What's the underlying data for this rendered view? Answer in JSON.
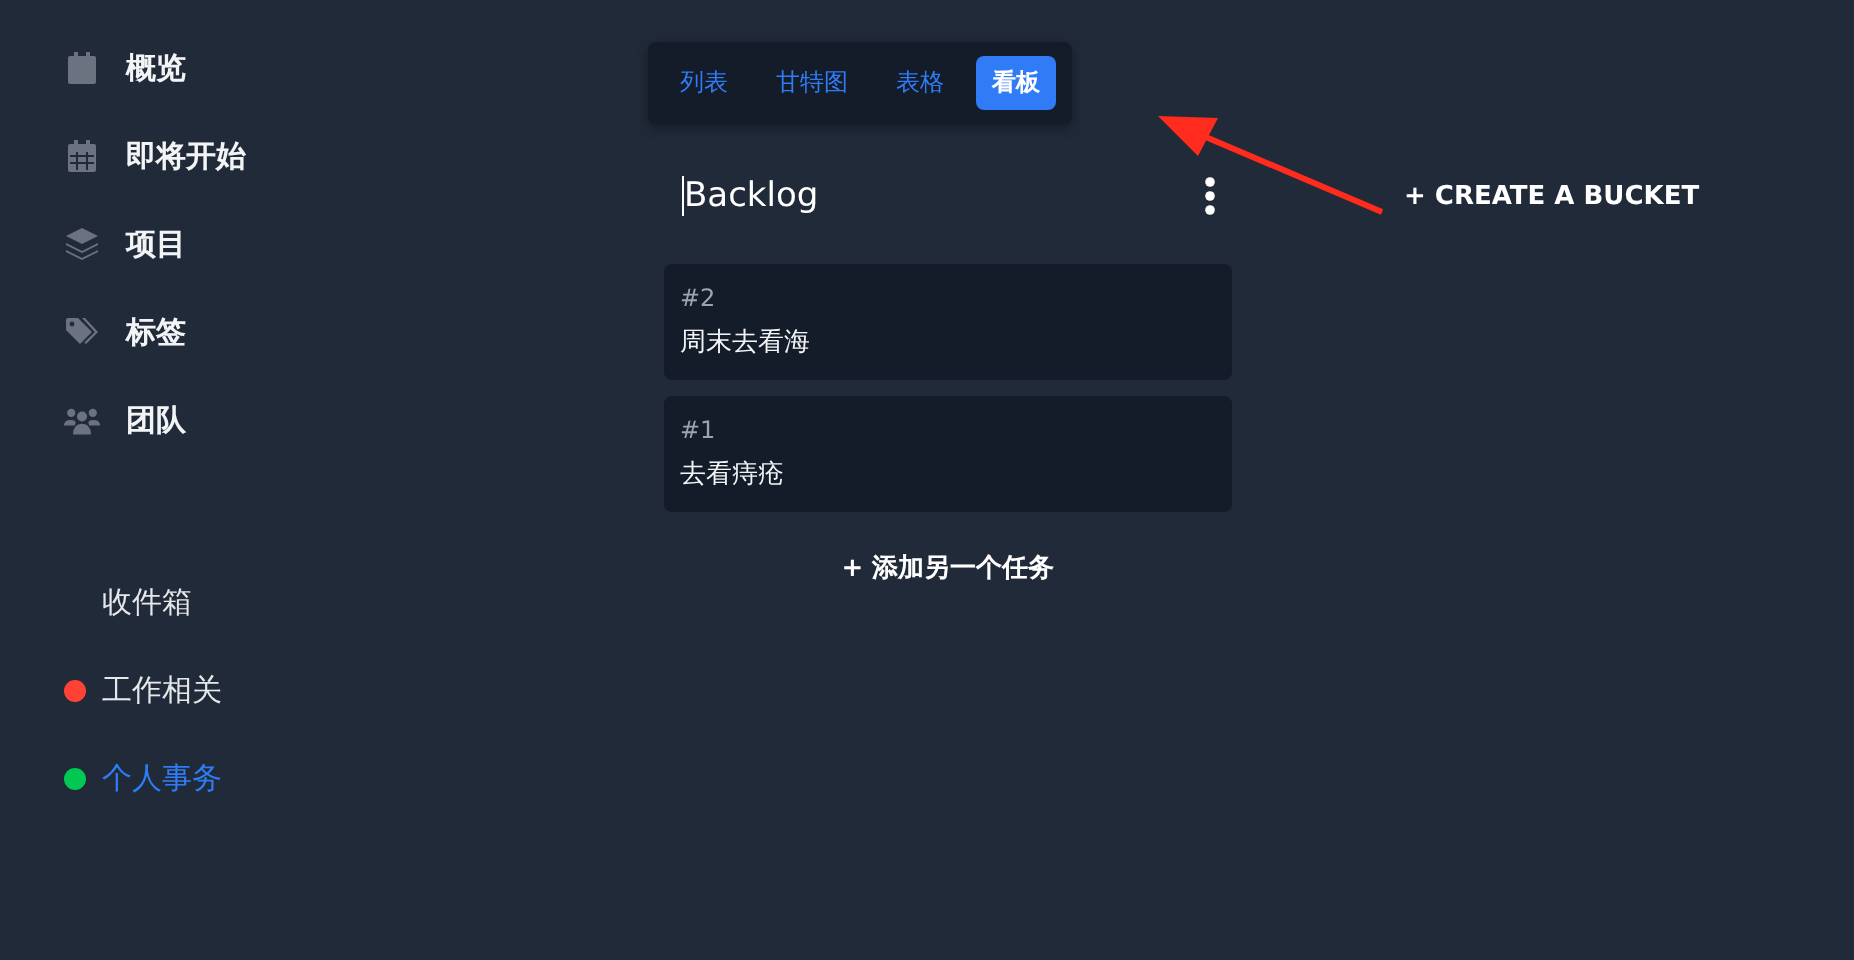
{
  "sidebar": {
    "menu": [
      {
        "kind": "calendar",
        "label": "概览"
      },
      {
        "kind": "calendar-grid",
        "label": "即将开始"
      },
      {
        "kind": "layers",
        "label": "项目"
      },
      {
        "kind": "tags",
        "label": "标签"
      },
      {
        "kind": "users",
        "label": "团队"
      }
    ],
    "projects": [
      {
        "label": "收件箱",
        "selected": false
      },
      {
        "label": "工作相关",
        "selected": false,
        "color": "#ff4136"
      },
      {
        "label": "个人事务",
        "selected": true,
        "color": "#00c853"
      }
    ]
  },
  "view_tabs": [
    {
      "label": "列表",
      "selected": false
    },
    {
      "label": "甘特图",
      "selected": false
    },
    {
      "label": "表格",
      "selected": false
    },
    {
      "label": "看板",
      "selected": true
    }
  ],
  "bucket": {
    "title": "Backlog",
    "tasks": [
      {
        "number": "#2",
        "title": "周末去看海"
      },
      {
        "number": "#1",
        "title": "去看痔疮"
      }
    ],
    "add_task": "+ 添加另一个任务"
  },
  "create_bucket": "+ CREATE A BUCKET"
}
